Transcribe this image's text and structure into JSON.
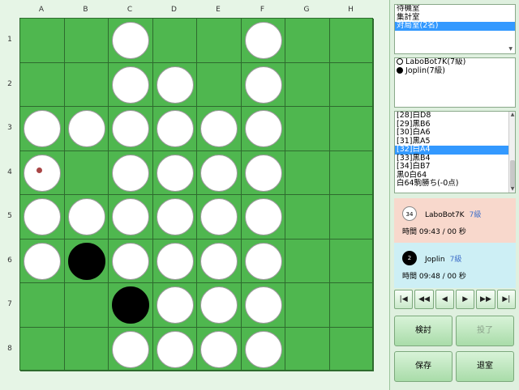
{
  "board": {
    "columns": [
      "A",
      "B",
      "C",
      "D",
      "E",
      "F",
      "G",
      "H"
    ],
    "rows": [
      "1",
      "2",
      "3",
      "4",
      "5",
      "6",
      "7",
      "8"
    ],
    "grid": [
      [
        "",
        "",
        "W",
        "",
        "",
        "W",
        "",
        ""
      ],
      [
        "",
        "",
        "W",
        "W",
        "",
        "W",
        "",
        ""
      ],
      [
        "W",
        "W",
        "W",
        "W",
        "W",
        "W",
        "",
        ""
      ],
      [
        "W",
        "",
        "W",
        "W",
        "W",
        "W",
        "",
        ""
      ],
      [
        "W",
        "W",
        "W",
        "W",
        "W",
        "W",
        "",
        ""
      ],
      [
        "W",
        "B",
        "W",
        "W",
        "W",
        "W",
        "",
        ""
      ],
      [
        "",
        "",
        "B",
        "W",
        "W",
        "W",
        "",
        ""
      ],
      [
        "",
        "",
        "W",
        "W",
        "W",
        "W",
        "",
        ""
      ]
    ],
    "last_move": "A4",
    "colors": {
      "board": "#4fb74f",
      "line": "#2e6b2e",
      "marker": "#a84545"
    }
  },
  "rooms": {
    "items": [
      "待機室",
      "集計室",
      "対局室(2名)"
    ],
    "selected_index": 2
  },
  "players_list": {
    "items": [
      {
        "disc": "white",
        "label": "LaboBot7K(7級)"
      },
      {
        "disc": "black",
        "label": "Joplin(7級)"
      }
    ]
  },
  "moves": {
    "items": [
      "[28]白D8",
      "[29]黒B6",
      "[30]白A6",
      "[31]黒A5",
      "[32]白A4",
      "[33]黒B4",
      "[34]白B7",
      "黒0白64",
      "白64駒勝ち(-0点)"
    ],
    "selected_index": 4
  },
  "player_white": {
    "count": "34",
    "name": "LaboBot7K",
    "rank": "7級",
    "time": "時間 09:43 / 00 秒",
    "bg": "#f8d8cc"
  },
  "player_black": {
    "count": "2",
    "name": "Joplin",
    "rank": "7級",
    "time": "時間 09:48 / 00 秒",
    "bg": "#cdeff5"
  },
  "nav": {
    "first": "|◀",
    "prev_fast": "◀◀",
    "prev": "◀",
    "next": "▶",
    "next_fast": "▶▶",
    "last": "▶|"
  },
  "actions": {
    "review": "検討",
    "resign": "投了",
    "save": "保存",
    "leave": "退室"
  }
}
